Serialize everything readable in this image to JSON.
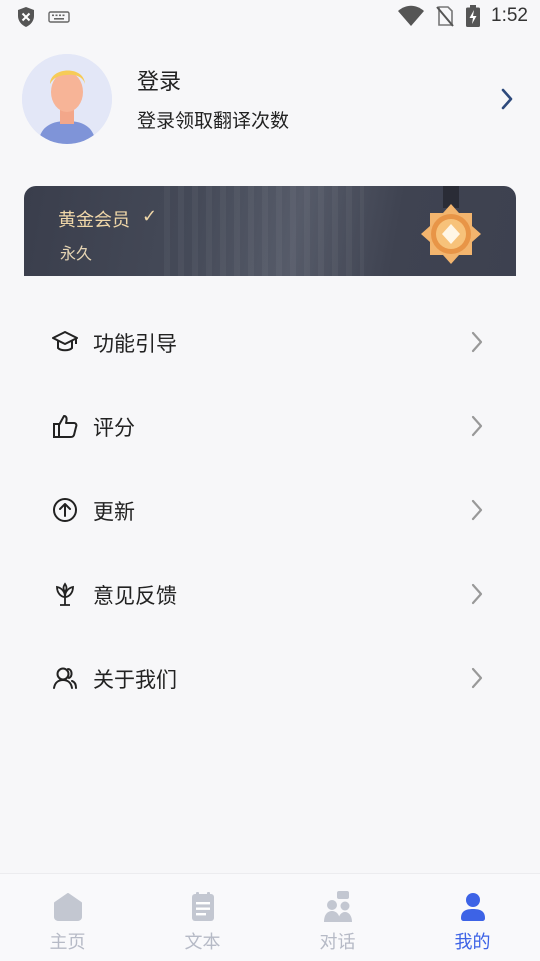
{
  "status_bar": {
    "time": "1:52",
    "icons": [
      "shield-x-icon",
      "keyboard-icon",
      "wifi-icon",
      "no-sim-icon",
      "battery-charging-icon"
    ]
  },
  "profile": {
    "title": "登录",
    "subtitle": "登录领取翻译次数"
  },
  "vip": {
    "title": "黄金会员",
    "check": "✓",
    "subtitle": "永久",
    "colors": {
      "text": "#f0d7a8",
      "medal": "#f0a75a"
    }
  },
  "menu": {
    "items": [
      {
        "label": "功能引导",
        "icon": "graduation-cap-icon"
      },
      {
        "label": "评分",
        "icon": "thumbs-up-icon"
      },
      {
        "label": "更新",
        "icon": "arrow-up-circle-icon"
      },
      {
        "label": "意见反馈",
        "icon": "flower-icon"
      },
      {
        "label": "关于我们",
        "icon": "users-icon"
      }
    ]
  },
  "bottom_nav": {
    "items": [
      {
        "label": "主页",
        "icon": "home-icon",
        "active": false
      },
      {
        "label": "文本",
        "icon": "document-icon",
        "active": false
      },
      {
        "label": "对话",
        "icon": "conversation-icon",
        "active": false
      },
      {
        "label": "我的",
        "icon": "user-icon",
        "active": true
      }
    ],
    "active_color": "#3d63e6",
    "inactive_color": "#c3c7d1"
  }
}
